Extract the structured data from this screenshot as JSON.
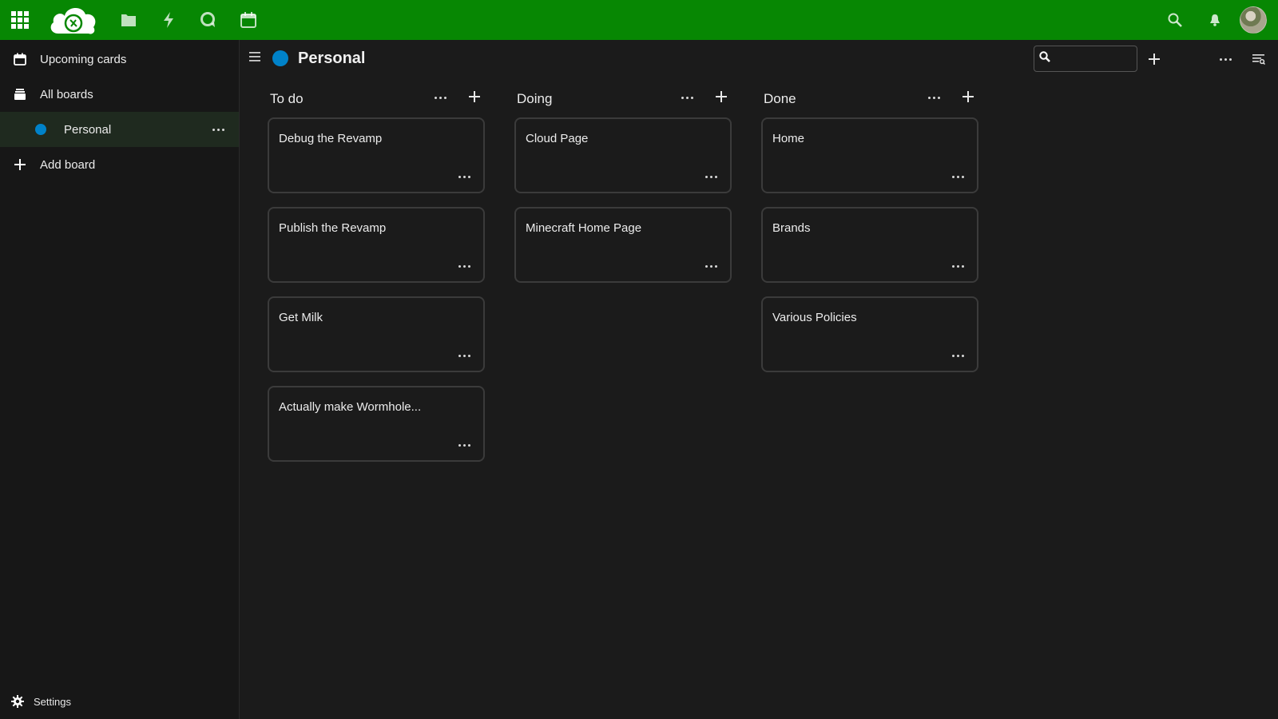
{
  "header": {
    "app_icons": [
      "apps-grid-icon",
      "nextcloud-logo",
      "files-icon",
      "activity-icon",
      "talk-icon",
      "calendar-icon"
    ],
    "right_icons": [
      "search-icon",
      "bell-icon",
      "avatar"
    ]
  },
  "sidebar": {
    "items": [
      {
        "label": "Upcoming cards",
        "icon": "calendar-icon"
      },
      {
        "label": "All boards",
        "icon": "stack-icon"
      },
      {
        "label": "Personal",
        "icon": "board-dot"
      },
      {
        "label": "Add board",
        "icon": "plus-icon"
      }
    ],
    "settings_label": "Settings"
  },
  "board": {
    "title": "Personal",
    "color": "#0082c9",
    "search_value": ""
  },
  "columns": [
    {
      "title": "To do",
      "cards": [
        "Debug the Revamp",
        "Publish the Revamp",
        "Get Milk",
        "Actually make Wormhole..."
      ]
    },
    {
      "title": "Doing",
      "cards": [
        "Cloud Page",
        "Minecraft Home Page"
      ]
    },
    {
      "title": "Done",
      "cards": [
        "Home",
        "Brands",
        "Various Policies"
      ]
    }
  ],
  "colors": {
    "header_bg": "#078703",
    "accent_blue": "#0082c9",
    "background": "#1b1b1b"
  }
}
